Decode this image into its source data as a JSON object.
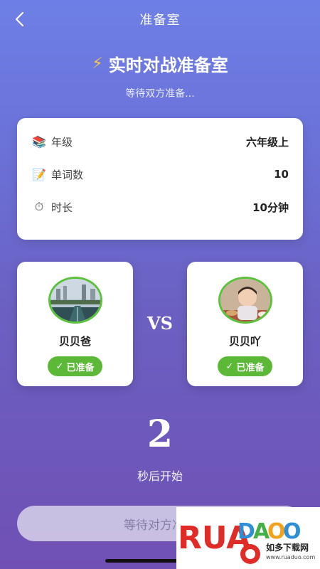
{
  "nav": {
    "title": "准备室"
  },
  "header": {
    "title": "实时对战准备室",
    "subtitle": "等待双方准备..."
  },
  "info": [
    {
      "icon": "books-icon",
      "glyph": "📚",
      "label": "年级",
      "value": "六年级上"
    },
    {
      "icon": "memo-icon",
      "glyph": "📝",
      "label": "单词数",
      "value": "10"
    },
    {
      "icon": "stopwatch-icon",
      "glyph": "⏱",
      "label": "时长",
      "value": "10分钟"
    }
  ],
  "players": {
    "left": {
      "name": "贝贝爸",
      "status": "已准备"
    },
    "right": {
      "name": "贝贝吖",
      "status": "已准备"
    }
  },
  "vs": "VS",
  "countdown": {
    "value": "2",
    "label": "秒后开始"
  },
  "wait_button": {
    "label": "等待对方准备"
  },
  "watermark": {
    "brand": "RUANDAOO",
    "cn": "如多下载网",
    "url": "www.ruaduo.com"
  },
  "colors": {
    "ready": "#5cb938",
    "avatar_border": "#5cc23c",
    "bolt": "#f7c84a"
  }
}
